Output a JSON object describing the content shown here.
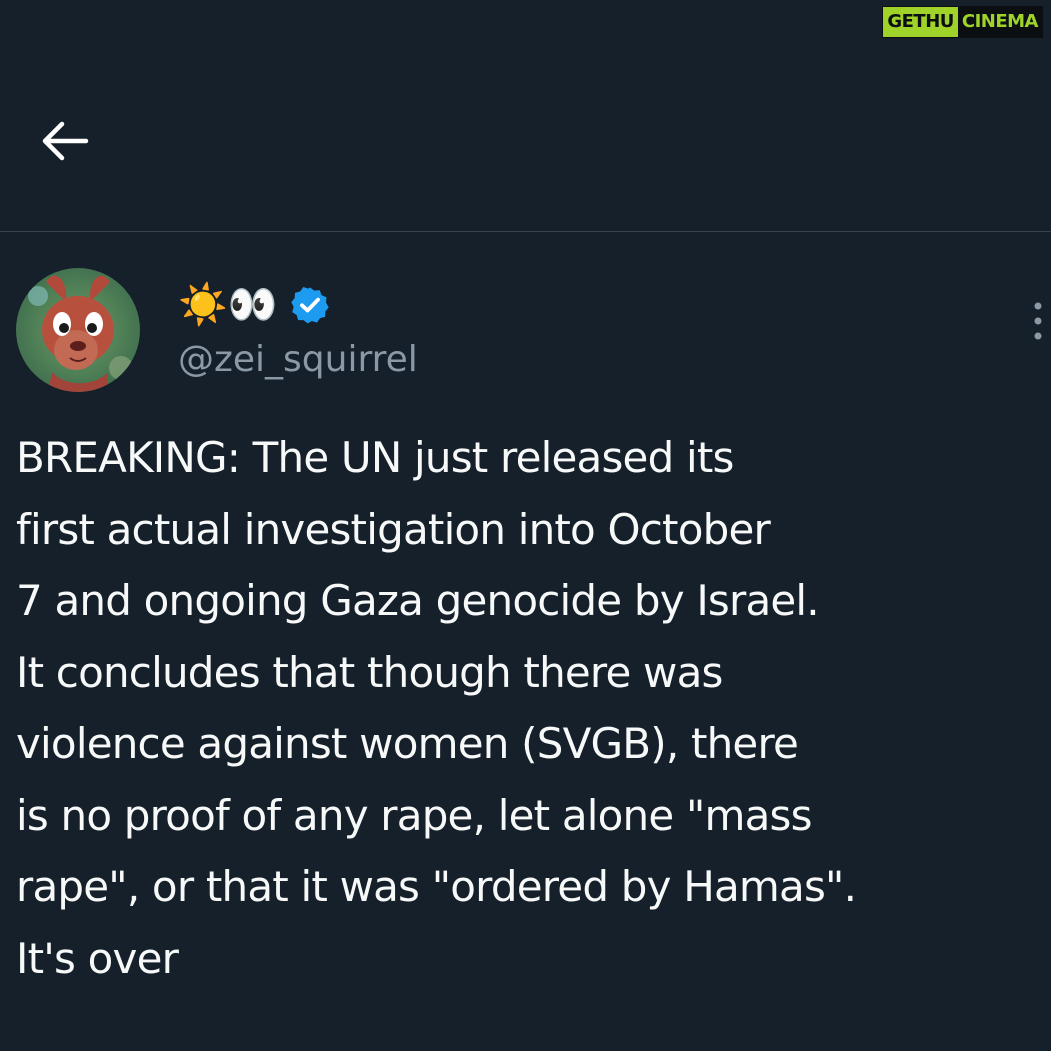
{
  "watermark": {
    "part1": "GETHU",
    "part2": "CINEMA"
  },
  "header": {
    "back_icon": "arrow-left-icon"
  },
  "author": {
    "display_name": "☀️👀",
    "handle": "@zei_squirrel",
    "verified_icon": "verified-badge-icon",
    "verified_color": "#1d9bf0",
    "avatar_icon": "squirrel-cartoon-avatar"
  },
  "tweet": {
    "text": "BREAKING: The UN just released its\nfirst actual investigation into October\n7 and ongoing Gaza genocide by Israel.\nIt concludes that though there was\nviolence against women (SVGB), there\nis no proof of any rape, let alone \"mass\nrape\", or that it was \"ordered by Hamas\".\nIt's over"
  },
  "menu": {
    "more_icon": "more-vertical-icon"
  },
  "colors": {
    "background": "#15202b",
    "divider": "#38444d",
    "secondary_text": "#8b98a5",
    "watermark_green": "#9fd32a"
  }
}
